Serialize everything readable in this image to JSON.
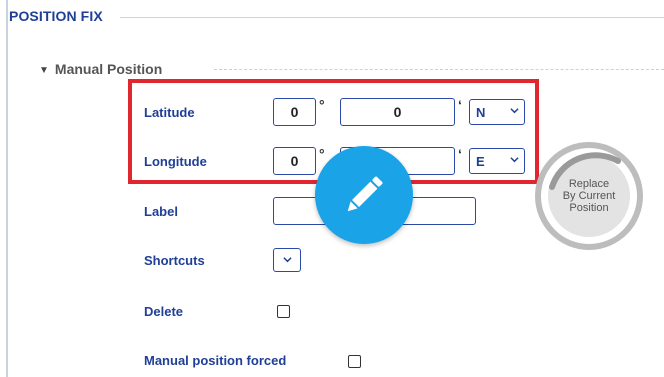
{
  "section": {
    "title": "POSITION FIX"
  },
  "manual": {
    "toggle_glyph": "▼",
    "title": "Manual Position"
  },
  "latitude": {
    "label": "Latitude",
    "degrees": "0",
    "degree_symbol": "°",
    "minutes": "0",
    "minute_symbol": "‘",
    "hemisphere": "N"
  },
  "longitude": {
    "label": "Longitude",
    "degrees": "0",
    "degree_symbol": "°",
    "minutes": "",
    "minute_symbol": "‘",
    "hemisphere": "E"
  },
  "label_field": {
    "label": "Label",
    "value": ""
  },
  "shortcuts": {
    "label": "Shortcuts",
    "value": ""
  },
  "delete": {
    "label": "Delete",
    "checked": false
  },
  "manual_forced": {
    "label": "Manual position forced",
    "checked": false
  },
  "replace_button": {
    "line1": "Replace",
    "line2": "By Current",
    "line3": "Position"
  },
  "colors": {
    "accent": "#1f3f96",
    "field_border": "#2b49a8",
    "highlight": "#e0262e",
    "fab": "#1aa3e6"
  },
  "icons": {
    "dropdown": "chevron-down-icon",
    "edit": "pencil-icon"
  }
}
